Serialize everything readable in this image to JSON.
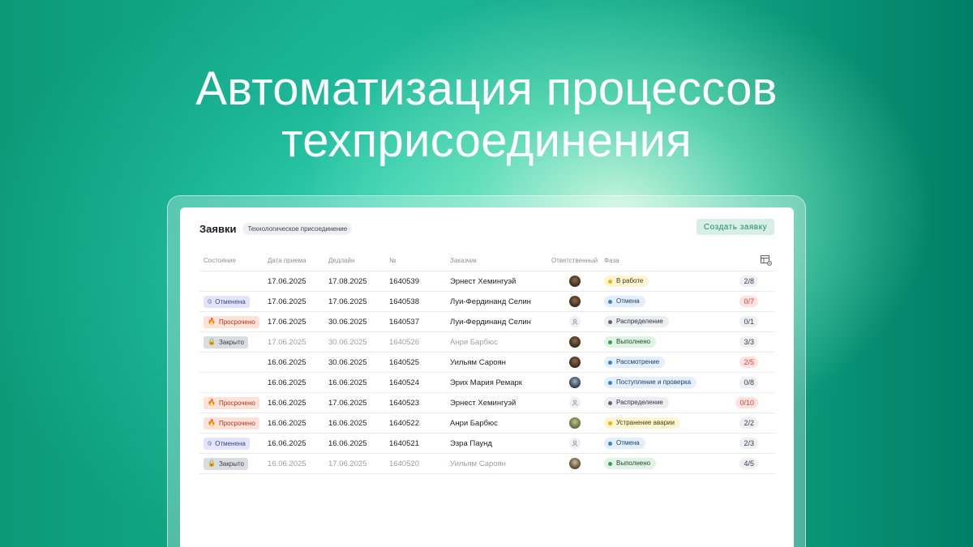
{
  "headline": {
    "line1": "Автоматизация процессов",
    "line2": "техприсоединения"
  },
  "panel": {
    "title": "Заявки",
    "subtag": "Технологическое присоединение",
    "create_label": "Создать заявку"
  },
  "columns": {
    "state": "Состояние",
    "date": "Дата приема",
    "deadline": "Дедлайн",
    "number": "№",
    "customer": "Заказчик",
    "responsible": "Ответственный",
    "phase": "Фаза",
    "settings_icon": "table-settings-icon"
  },
  "colors": {
    "accent": "#1e8a68",
    "yellow": "#f0b400",
    "blue": "#2d84dd",
    "gray": "#5a6470",
    "green": "#2ea44f",
    "red": "#d1463b"
  },
  "rows": [
    {
      "state": "",
      "date": "17.06.2025",
      "deadline": "17.08.2025",
      "number": "1640539",
      "customer": "Эрнест Хемингуэй",
      "avatar": "photo",
      "phase": "В работе",
      "phase_color": "yellow",
      "count": "2/8",
      "count_red": false,
      "muted": false
    },
    {
      "state": "Отменена",
      "state_type": "cancel",
      "date": "17.06.2025",
      "deadline": "17.06.2025",
      "number": "1640538",
      "customer": "Луи-Фердинанд Селин",
      "avatar": "photo",
      "phase": "Отмена",
      "phase_color": "blue",
      "count": "0/7",
      "count_red": true,
      "muted": false
    },
    {
      "state": "Просрочено",
      "state_type": "overdue",
      "date": "17.06.2025",
      "deadline": "30.06.2025",
      "number": "1640537",
      "customer": "Луи-Фердинанд Селин",
      "avatar": "empty",
      "phase": "Распределение",
      "phase_color": "gray",
      "count": "0/1",
      "count_red": false,
      "muted": false
    },
    {
      "state": "Закрыто",
      "state_type": "closed",
      "date": "17.06.2025",
      "deadline": "30.06.2025",
      "number": "1640526",
      "customer": "Анри Барбюс",
      "avatar": "photo",
      "phase": "Выполнено",
      "phase_color": "green",
      "count": "3/3",
      "count_red": false,
      "muted": true
    },
    {
      "state": "",
      "date": "16.06.2025",
      "deadline": "30.06.2025",
      "number": "1640525",
      "customer": "Уильям Сароян",
      "avatar": "photo",
      "phase": "Рассмотрение",
      "phase_color": "blue",
      "count": "2/5",
      "count_red": true,
      "muted": false
    },
    {
      "state": "",
      "date": "16.06.2025",
      "deadline": "16.06.2025",
      "number": "1640524",
      "customer": "Эрих Мария Ремарк",
      "avatar": "photo2",
      "phase": "Поступление и проверка",
      "phase_color": "blue",
      "count": "0/8",
      "count_red": false,
      "muted": false
    },
    {
      "state": "Просрочено",
      "state_type": "overdue",
      "date": "16.06.2025",
      "deadline": "17.06.2025",
      "number": "1640523",
      "customer": "Эрнест Хемингуэй",
      "avatar": "empty",
      "phase": "Распределение",
      "phase_color": "gray",
      "count": "0/10",
      "count_red": true,
      "muted": false
    },
    {
      "state": "Просрочено",
      "state_type": "overdue",
      "date": "16.06.2025",
      "deadline": "16.06.2025",
      "number": "1640522",
      "customer": "Анри Барбюс",
      "avatar": "photo3",
      "phase": "Устранение аварии",
      "phase_color": "yellow",
      "count": "2/2",
      "count_red": false,
      "muted": false
    },
    {
      "state": "Отменена",
      "state_type": "cancel",
      "date": "16.06.2025",
      "deadline": "16.06.2025",
      "number": "1640521",
      "customer": "Эзра Паунд",
      "avatar": "empty",
      "phase": "Отмена",
      "phase_color": "blue",
      "count": "2/3",
      "count_red": false,
      "muted": false
    },
    {
      "state": "Закрыто",
      "state_type": "closed",
      "date": "16.06.2025",
      "deadline": "17.06.2025",
      "number": "1640520",
      "customer": "Уильям Сароян",
      "avatar": "photo4",
      "phase": "Выполнено",
      "phase_color": "green",
      "count": "4/5",
      "count_red": false,
      "muted": true
    }
  ]
}
